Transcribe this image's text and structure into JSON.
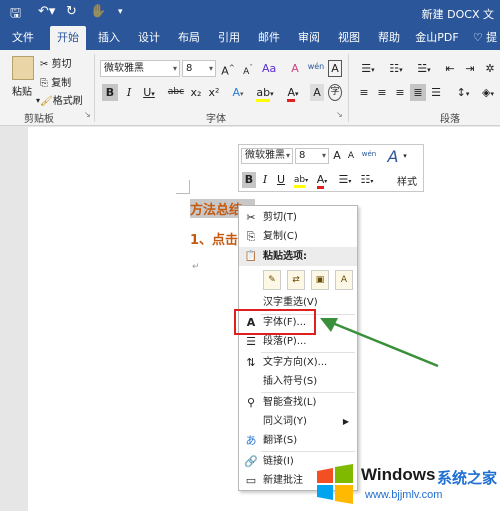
{
  "titlebar": {
    "save_icon": "save-icon",
    "undo_icon": "undo-icon",
    "redo_icon": "redo-icon",
    "title": "新建 DOCX 文"
  },
  "tabs": [
    {
      "label": "文件"
    },
    {
      "label": "开始"
    },
    {
      "label": "插入"
    },
    {
      "label": "设计"
    },
    {
      "label": "布局"
    },
    {
      "label": "引用"
    },
    {
      "label": "邮件"
    },
    {
      "label": "审阅"
    },
    {
      "label": "视图"
    },
    {
      "label": "帮助"
    },
    {
      "label": "金山PDF"
    },
    {
      "label": "提"
    }
  ],
  "active_tab": "开始",
  "ribbon": {
    "clipboard": {
      "paste": "粘贴",
      "cut": "剪切",
      "copy": "复制",
      "format_painter": "格式刷",
      "group_label": "剪贴板"
    },
    "font": {
      "font_name": "微软雅黑",
      "font_size": "8",
      "grow": "A",
      "shrink": "A",
      "clear": "A",
      "phonetic": "wén",
      "border": "A",
      "bold": "B",
      "italic": "I",
      "underline": "U",
      "strike": "abc",
      "sub": "x₂",
      "sup": "x²",
      "group_label": "字体"
    },
    "paragraph": {
      "group_label": "段落"
    }
  },
  "document": {
    "heading": "方法总结：",
    "step": "1、点击",
    "para_mark": "↵"
  },
  "mini_toolbar": {
    "font_name": "微软雅黑",
    "font_size": "8",
    "bold": "B",
    "italic": "I",
    "styles_label": "样式"
  },
  "context_menu": {
    "cut": "剪切(T)",
    "copy": "复制(C)",
    "paste_options": "粘贴选项:",
    "reconvert": "汉字重选(V)",
    "font": "字体(F)...",
    "paragraph": "段落(P)...",
    "text_direction": "文字方向(X)...",
    "insert_symbol": "插入符号(S)",
    "smart_lookup": "智能查找(L)",
    "synonyms": "同义词(Y)",
    "translate": "翻译(S)",
    "link": "链接(I)",
    "new_comment": "新建批注"
  },
  "watermark": {
    "brand": "Windows",
    "cn": "系统之家",
    "url": "www.bjjmlv.com"
  },
  "colors": {
    "accent": "#2b579a",
    "heading": "#c55a11",
    "highlight_box": "#e02020",
    "arrow": "#3a8f3a"
  }
}
